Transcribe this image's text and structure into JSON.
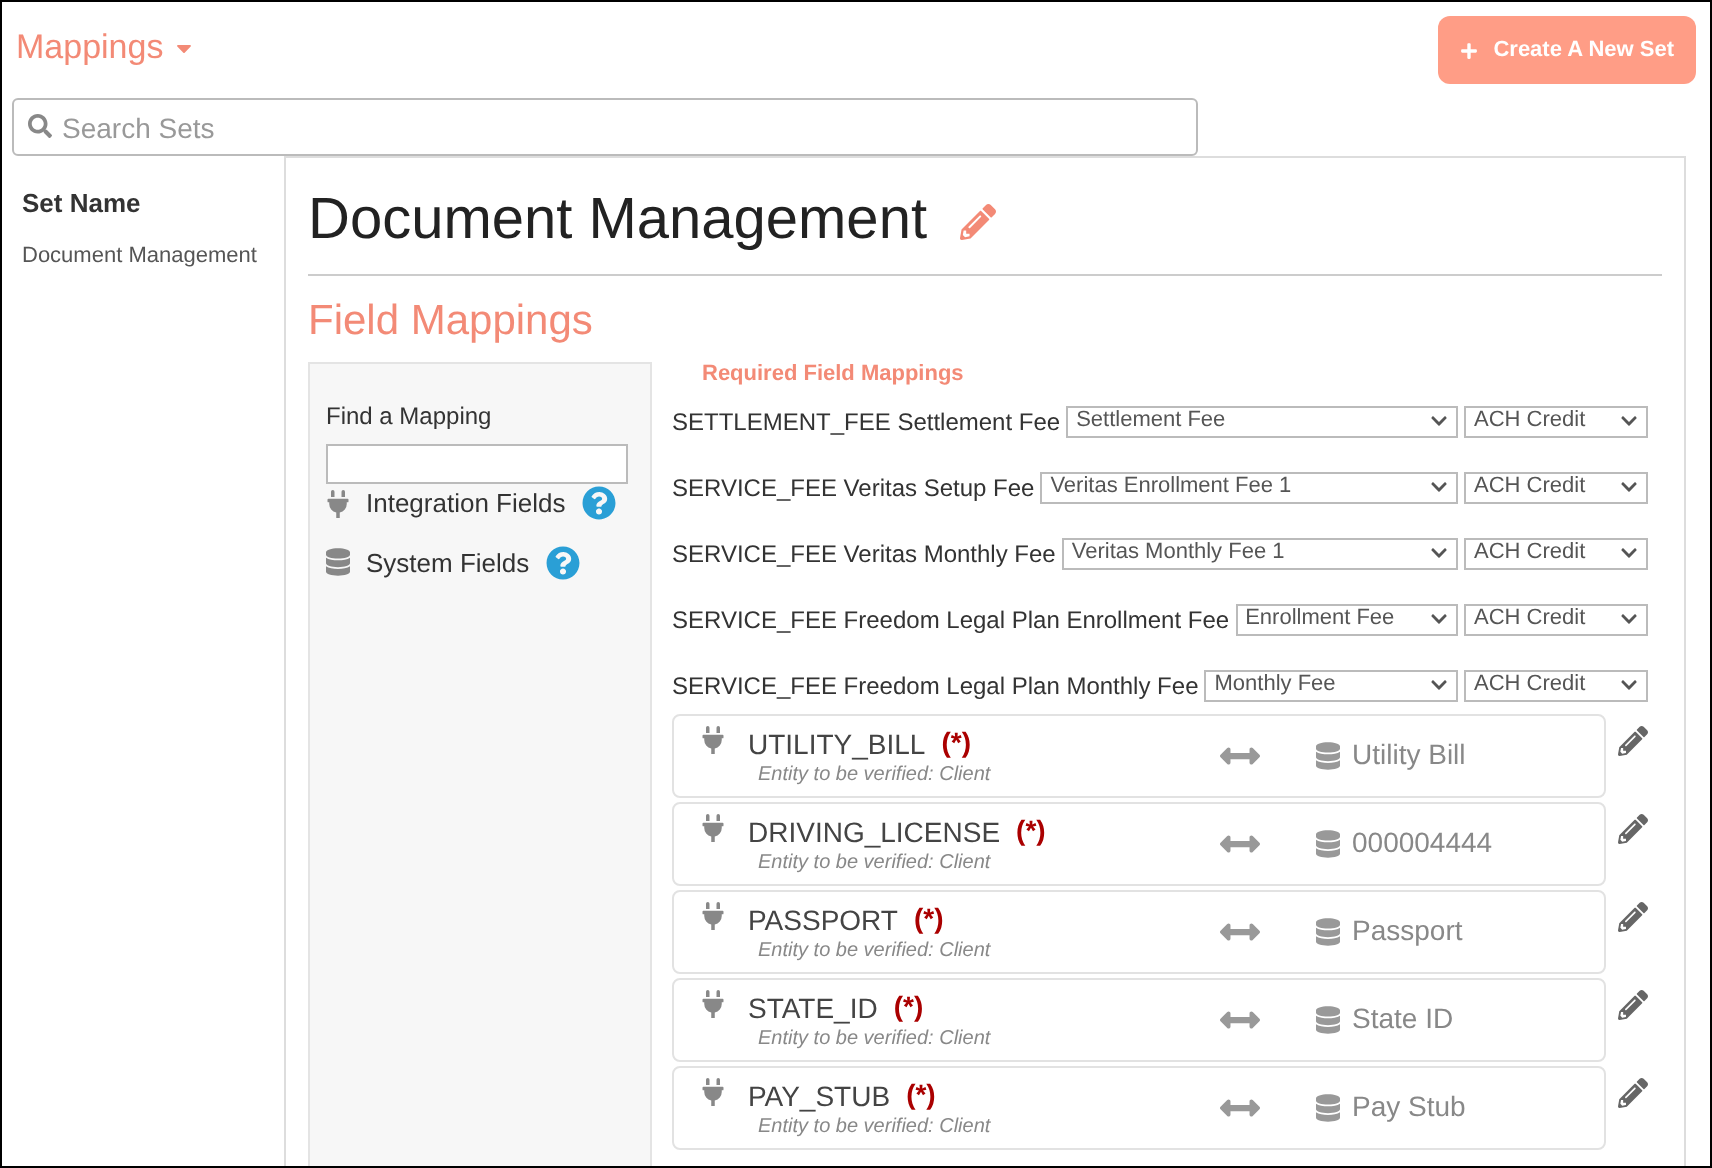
{
  "header": {
    "title": "Mappings",
    "create_button": "Create A New Set"
  },
  "search": {
    "placeholder": "Search Sets"
  },
  "sidebar": {
    "heading": "Set Name",
    "items": [
      "Document Management"
    ]
  },
  "set_title": "Document Management",
  "section_title": "Field Mappings",
  "filter_panel": {
    "find_label": "Find a Mapping",
    "legend": [
      {
        "kind": "integration",
        "label": "Integration Fields"
      },
      {
        "kind": "system",
        "label": "System Fields"
      }
    ]
  },
  "required": {
    "title": "Required Field Mappings",
    "rows": [
      {
        "label": "SETTLEMENT_FEE Settlement Fee",
        "fee": "Settlement Fee",
        "method": "ACH Credit"
      },
      {
        "label": "SERVICE_FEE Veritas Setup Fee",
        "fee": "Veritas Enrollment Fee 1",
        "method": "ACH Credit"
      },
      {
        "label": "SERVICE_FEE Veritas Monthly Fee",
        "fee": "Veritas Monthly Fee 1",
        "method": "ACH Credit"
      },
      {
        "label": "SERVICE_FEE Freedom Legal Plan Enrollment Fee",
        "fee": "Enrollment Fee",
        "method": "ACH Credit"
      },
      {
        "label": "SERVICE_FEE Freedom Legal Plan Monthly Fee",
        "fee": "Monthly Fee",
        "method": "ACH Credit"
      }
    ]
  },
  "mappings": [
    {
      "field": "UTILITY_BILL",
      "required_mark": "(*)",
      "note": "Entity to be verified: Client",
      "target": "Utility Bill"
    },
    {
      "field": "DRIVING_LICENSE",
      "required_mark": "(*)",
      "note": "Entity to be verified: Client",
      "target": "000004444"
    },
    {
      "field": "PASSPORT",
      "required_mark": "(*)",
      "note": "Entity to be verified: Client",
      "target": "Passport"
    },
    {
      "field": "STATE_ID",
      "required_mark": "(*)",
      "note": "Entity to be verified: Client",
      "target": "State ID"
    },
    {
      "field": "PAY_STUB",
      "required_mark": "(*)",
      "note": "Entity to be verified: Client",
      "target": "Pay Stub"
    }
  ]
}
